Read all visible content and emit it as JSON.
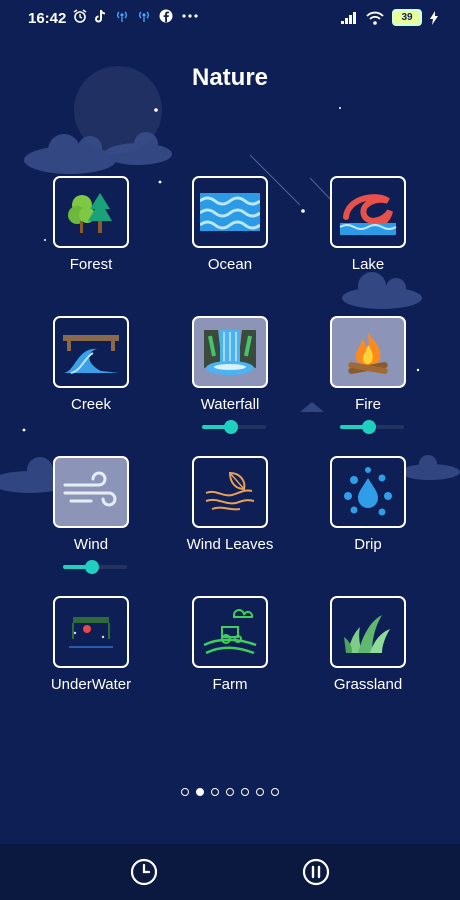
{
  "status_bar": {
    "time": "16:42",
    "left_icons": [
      "alarm-icon",
      "tiktok-icon",
      "broadcast-icon",
      "broadcast-icon",
      "facebook-icon",
      "more-dots-icon"
    ],
    "right_icons": [
      "signal-icon",
      "wifi-icon"
    ],
    "battery": "39"
  },
  "page": {
    "title": "Nature"
  },
  "sounds": [
    {
      "label": "Forest",
      "icon": "forest-icon",
      "active": false
    },
    {
      "label": "Ocean",
      "icon": "ocean-icon",
      "active": false
    },
    {
      "label": "Lake",
      "icon": "lake-icon",
      "active": false
    },
    {
      "label": "Creek",
      "icon": "creek-icon",
      "active": false
    },
    {
      "label": "Waterfall",
      "icon": "waterfall-icon",
      "active": true,
      "volume": 0.45
    },
    {
      "label": "Fire",
      "icon": "fire-icon",
      "active": true,
      "volume": 0.45
    },
    {
      "label": "Wind",
      "icon": "wind-icon",
      "active": true,
      "volume": 0.45
    },
    {
      "label": "Wind Leaves",
      "icon": "wind-leaves-icon",
      "active": false
    },
    {
      "label": "Drip",
      "icon": "drip-icon",
      "active": false
    },
    {
      "label": "UnderWater",
      "icon": "underwater-icon",
      "active": false
    },
    {
      "label": "Farm",
      "icon": "farm-icon",
      "active": false
    },
    {
      "label": "Grassland",
      "icon": "grassland-icon",
      "active": false
    }
  ],
  "pager": {
    "count": 7,
    "current": 1
  },
  "bottom_bar": {
    "buttons": [
      "timer-icon",
      "pause-icon"
    ]
  },
  "colors": {
    "background": "#0e1f55",
    "accent": "#1fd0c0",
    "active_tile": "#8c95b8"
  }
}
